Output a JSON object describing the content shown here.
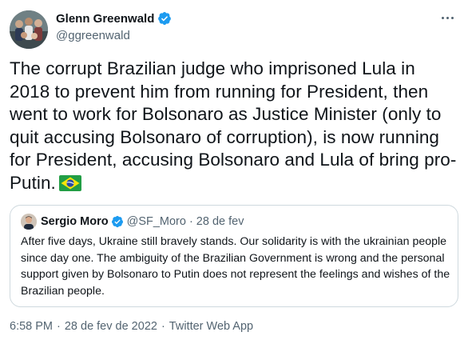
{
  "author": {
    "name": "Glenn Greenwald",
    "handle": "@ggreenwald",
    "verified_color": "#1d9bf0",
    "avatar_icon": "group-photo-avatar"
  },
  "tweet": {
    "text": "The corrupt Brazilian judge who imprisoned Lula in 2018 to prevent him from running for President, then went to work for Bolsonaro as Justice Minister (only to quit accusing Bolsonaro of corruption), is now running for President, accusing Bolsonaro and Lula of bring pro-Putin.",
    "emoji": "brazil-flag-icon"
  },
  "quote": {
    "name": "Sergio Moro",
    "handle": "@SF_Moro",
    "separator": "·",
    "date": "28 de fev",
    "text": "After five days, Ukraine still bravely stands. Our solidarity is with the ukrainian people since day one. The ambiguity of the Brazilian Government is wrong and the personal support given by Bolsonaro to Putin does not represent the feelings and wishes of the Brazilian people."
  },
  "meta": {
    "time": "6:58 PM",
    "separator": "·",
    "date": "28 de fev de 2022",
    "source": "Twitter Web App"
  },
  "colors": {
    "text": "#0f1419",
    "secondary": "#536471",
    "border": "#cfd9de",
    "accent": "#1d9bf0"
  }
}
